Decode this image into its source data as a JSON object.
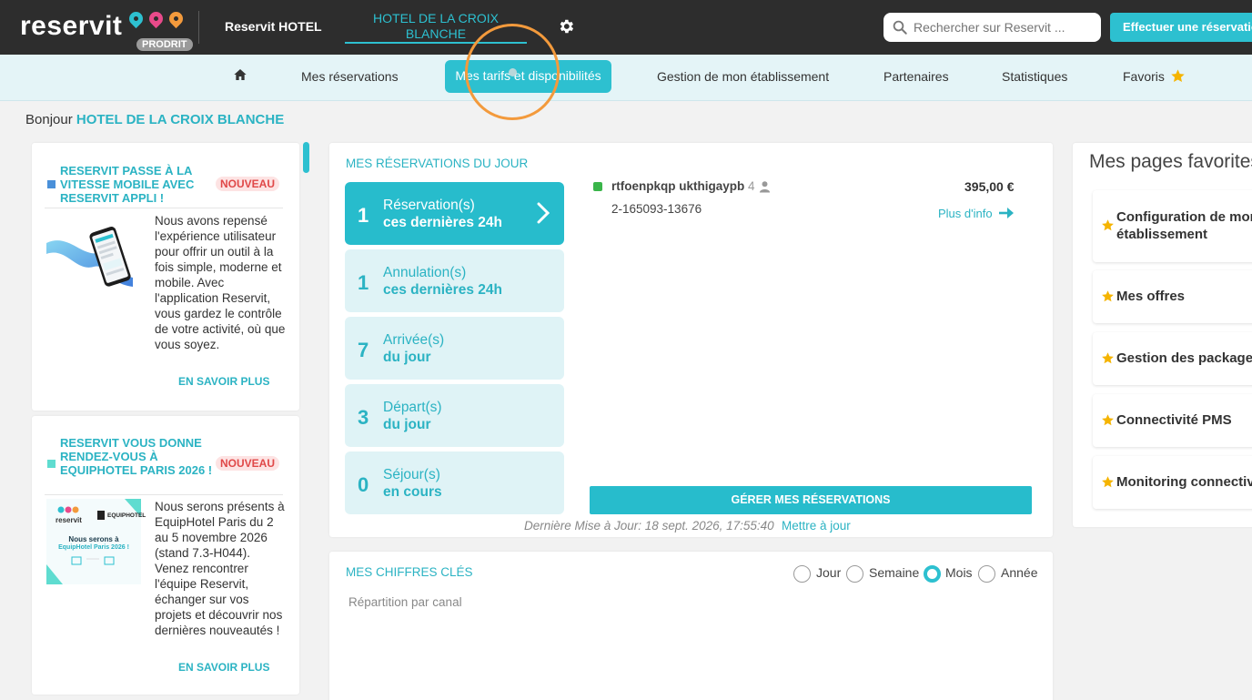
{
  "header": {
    "logo_text": "reservit",
    "logo_badge": "PRODRIT",
    "hotel_label": "Reservit HOTEL",
    "active_hotel_line1": "HOTEL DE LA CROIX",
    "active_hotel_line2": "BLANCHE",
    "search_placeholder": "Rechercher sur Reservit ...",
    "reserve_button": "Effectuer une réservation",
    "brand_color": "#2dc0d0",
    "pin_colors": [
      "#2dc0d0",
      "#e84a8a",
      "#f39a3c"
    ]
  },
  "nav": {
    "items": [
      {
        "label": "Mes réservations"
      },
      {
        "label": "Mes tarifs et disponibilités",
        "active": true
      },
      {
        "label": "Gestion de mon établissement"
      },
      {
        "label": "Partenaires"
      },
      {
        "label": "Statistiques"
      },
      {
        "label": "Favoris"
      }
    ]
  },
  "greeting": {
    "prefix": "Bonjour",
    "hotel": "HOTEL DE LA CROIX BLANCHE"
  },
  "news": [
    {
      "title": "RESERVIT PASSE À LA VITESSE MOBILE AVEC RESERVIT APPLI !",
      "badge": "NOUVEAU",
      "body": "Nous avons repensé l'expérience utilisateur pour offrir un outil à la fois simple, moderne et mobile. Avec l'application Reservit, vous gardez le contrôle de votre activité, où que vous soyez.",
      "more": "EN SAVOIR PLUS",
      "marker_color": "#4a90d9"
    },
    {
      "title": "RESERVIT VOUS DONNE RENDEZ-VOUS À EQUIPHOTEL PARIS 2026 !",
      "badge": "NOUVEAU",
      "body": "Nous serons présents à EquipHotel Paris du 2 au 5 novembre 2026 (stand 7.3-H044). Venez rencontrer l'équipe Reservit, échanger sur vos projets et découvrir nos dernières nouveautés !",
      "more": "EN SAVOIR PLUS",
      "marker_color": "#5fdcd0",
      "image_text": {
        "brand": "reservit",
        "partner": "EQUIPHOTEL",
        "line1": "Nous serons à",
        "line2": "EquipHotel Paris 2026 !"
      }
    }
  ],
  "reservations": {
    "title": "MES RÉSERVATIONS DU JOUR",
    "stats": [
      {
        "count": "1",
        "line1": "Réservation(s)",
        "line2": "ces dernières 24h",
        "active": true
      },
      {
        "count": "1",
        "line1": "Annulation(s)",
        "line2": "ces dernières 24h"
      },
      {
        "count": "7",
        "line1": "Arrivée(s)",
        "line2": "du jour"
      },
      {
        "count": "3",
        "line1": "Départ(s)",
        "line2": "du jour"
      },
      {
        "count": "0",
        "line1": "Séjour(s)",
        "line2": "en cours"
      }
    ],
    "entry": {
      "name": "rtfoenpkqp ukthigaypb",
      "persons": "4",
      "price": "395,00 €",
      "id": "2-165093-13676",
      "more": "Plus d'info",
      "status_color": "#3ab54a"
    },
    "manage_button": "GÉRER MES RÉSERVATIONS",
    "last_update": "Dernière Mise à Jour: 18 sept. 2026, 17:55:40",
    "update_link": "Mettre à jour"
  },
  "key_figures": {
    "title": "MES CHIFFRES CLÉS",
    "periods": [
      {
        "label": "Jour",
        "selected": false
      },
      {
        "label": "Semaine",
        "selected": false
      },
      {
        "label": "Mois",
        "selected": true
      },
      {
        "label": "Année",
        "selected": false
      }
    ],
    "subtitle": "Répartition par canal"
  },
  "favorites": {
    "title": "Mes pages favorites",
    "items": [
      {
        "label_line1": "Configuration de mon",
        "label_line2": "établissement"
      },
      {
        "label_line1": "Mes offres"
      },
      {
        "label_line1": "Gestion des packages"
      },
      {
        "label_line1": "Connectivité PMS"
      },
      {
        "label_line1": "Monitoring connectivité"
      }
    ],
    "star_color": "#f5b400"
  }
}
